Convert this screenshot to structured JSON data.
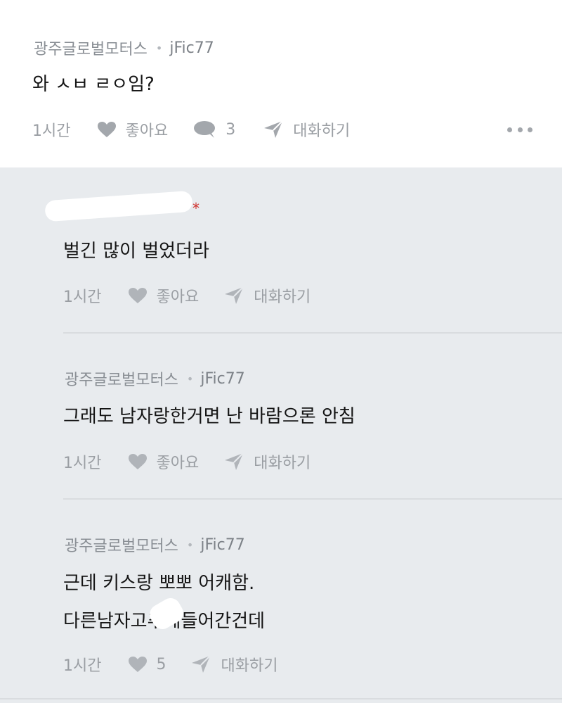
{
  "root": {
    "author": "광주글로벌모터스",
    "separator": "•",
    "handle": "jFic77",
    "text": "와 ㅅㅂ ㄹㅇ임?",
    "time": "1시간",
    "like_label": "좋아요",
    "reply_count": "3",
    "talk_label": "대화하기"
  },
  "replies": [
    {
      "author": "",
      "handle": "",
      "text": "벌긴 많이 벌었더라",
      "time": "1시간",
      "like_label": "좋아요",
      "talk_label": "대화하기",
      "badge": "*"
    },
    {
      "author": "광주글로벌모터스",
      "separator": "•",
      "handle": "jFic77",
      "text": "그래도 남자랑한거면 난 바람으론 안침",
      "time": "1시간",
      "like_label": "좋아요",
      "talk_label": "대화하기"
    },
    {
      "author": "광주글로벌모터스",
      "separator": "•",
      "handle": "jFic77",
      "text_line1": "근데 키스랑 뽀뽀 어캐함.",
      "text_line2": "다른남자고추에들어간건데",
      "time": "1시간",
      "like_label": "5",
      "talk_label": "대화하기"
    }
  ],
  "icons": {
    "heart": "heart-icon",
    "bubble": "comment-bubble-icon",
    "send": "send-icon",
    "more": "more-dots-icon"
  },
  "colors": {
    "thread_background": "#e8ebee",
    "root_background": "#ffffff",
    "muted_text": "#9a9ea3",
    "badge": "#d0312d"
  }
}
